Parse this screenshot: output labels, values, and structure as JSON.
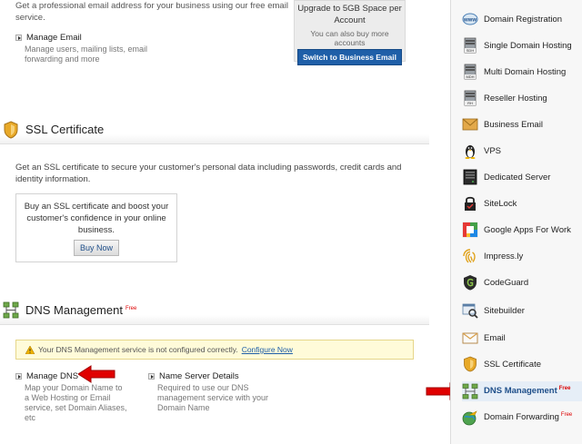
{
  "email": {
    "description": "Get a professional email address for your business using our free email service.",
    "manage_title": "Manage Email",
    "manage_desc": "Manage users, mailing lists, email forwarding and more",
    "upgrade_title": "Upgrade to 5GB Space per Account",
    "upgrade_note": "You can also buy more accounts",
    "switch_button": "Switch to Business Email"
  },
  "ssl": {
    "title": "SSL Certificate",
    "description": "Get an SSL certificate to secure your customer's personal data including passwords, credit cards and identity information.",
    "box_text": "Buy an SSL certificate and boost your customer's confidence in your online business.",
    "buy_button": "Buy Now"
  },
  "dns": {
    "title": "DNS Management",
    "free_badge": "Free",
    "warning_text": "Your DNS Management service is not configured correctly.",
    "warning_link": "Configure Now",
    "manage_title": "Manage DNS",
    "manage_desc": "Map your Domain Name to a Web Hosting or Email service, set Domain Aliases, etc",
    "ns_title": "Name Server Details",
    "ns_desc": "Required to use our DNS management service with your Domain Name"
  },
  "sidebar": {
    "items": [
      {
        "label": "Domain Registration",
        "icon": "www-icon"
      },
      {
        "label": "Single Domain Hosting",
        "icon": "sdh-server-icon"
      },
      {
        "label": "Multi Domain Hosting",
        "icon": "mdh-server-icon"
      },
      {
        "label": "Reseller Hosting",
        "icon": "rh-server-icon"
      },
      {
        "label": "Business Email",
        "icon": "envelope-icon"
      },
      {
        "label": "VPS",
        "icon": "linux-penguin-icon"
      },
      {
        "label": "Dedicated Server",
        "icon": "dedicated-server-icon"
      },
      {
        "label": "SiteLock",
        "icon": "lock-icon"
      },
      {
        "label": "Google Apps For Work",
        "icon": "google-apps-icon"
      },
      {
        "label": "Impress.ly",
        "icon": "fingerprint-icon"
      },
      {
        "label": "CodeGuard",
        "icon": "shield-g-icon"
      },
      {
        "label": "Sitebuilder",
        "icon": "sitebuilder-icon"
      },
      {
        "label": "Email",
        "icon": "email-icon"
      },
      {
        "label": "SSL Certificate",
        "icon": "ssl-shield-icon"
      },
      {
        "label": "DNS Management",
        "icon": "dns-network-icon",
        "badge": "Free",
        "active": true
      },
      {
        "label": "Domain Forwarding",
        "icon": "globe-arrow-icon",
        "badge": "Free"
      }
    ]
  },
  "colors": {
    "accent_blue": "#1f5fa8",
    "arrow_red": "#e00000",
    "warning_bg": "#fffbd9"
  }
}
